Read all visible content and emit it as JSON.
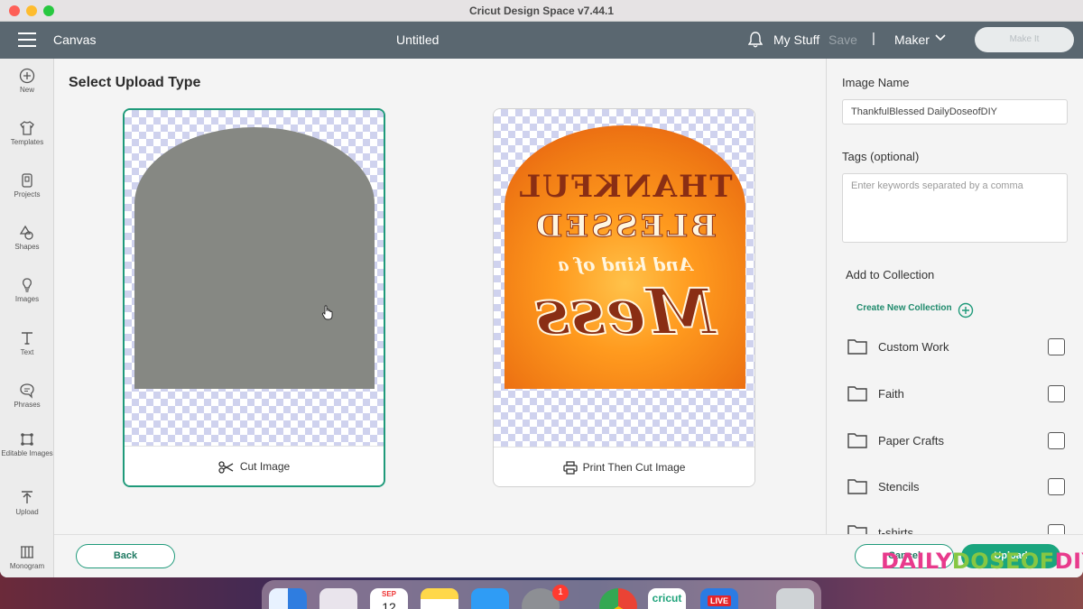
{
  "window": {
    "title": "Cricut Design Space  v7.44.1"
  },
  "topbar": {
    "canvas_label": "Canvas",
    "doc_title": "Untitled",
    "my_stuff": "My Stuff",
    "save": "Save",
    "separator": "|",
    "machine": "Maker",
    "make_it": "Make It"
  },
  "leftnav": {
    "items": [
      {
        "label": "New",
        "icon": "plus-circle-icon"
      },
      {
        "label": "Templates",
        "icon": "tshirt-icon"
      },
      {
        "label": "Projects",
        "icon": "projects-icon"
      },
      {
        "label": "Shapes",
        "icon": "shapes-icon"
      },
      {
        "label": "Images",
        "icon": "lightbulb-icon"
      },
      {
        "label": "Text",
        "icon": "text-icon"
      },
      {
        "label": "Phrases",
        "icon": "speech-bubble-icon"
      },
      {
        "label": "Editable Images",
        "icon": "editable-images-icon"
      },
      {
        "label": "Upload",
        "icon": "upload-icon"
      },
      {
        "label": "Monogram",
        "icon": "monogram-icon"
      }
    ]
  },
  "main": {
    "heading": "Select Upload Type",
    "cards": [
      {
        "label": "Cut Image",
        "selected": true
      },
      {
        "label": "Print Then Cut Image",
        "selected": false
      }
    ],
    "artwork": {
      "line1": "THANKFUL",
      "line2": "BLESSED",
      "line3": "And kind of a",
      "line4": "Mess"
    }
  },
  "bottombar": {
    "back": "Back",
    "cancel": "Cancel",
    "upload": "Upload"
  },
  "rightpanel": {
    "image_name_label": "Image Name",
    "image_name_value": "ThankfulBlessed DailyDoseofDIY",
    "tags_label": "Tags (optional)",
    "tags_placeholder": "Enter keywords separated by a comma",
    "collection_label": "Add to Collection",
    "create_collection": "Create New Collection",
    "collections": [
      {
        "name": "Custom Work",
        "checked": false
      },
      {
        "name": "Faith",
        "checked": false
      },
      {
        "name": "Paper Crafts",
        "checked": false
      },
      {
        "name": "Stencils",
        "checked": false
      },
      {
        "name": "t-shirts",
        "checked": false
      }
    ]
  },
  "watermark": {
    "part1": "DAILY",
    "part2": "DOSEOF",
    "part3": "DIY"
  },
  "dock": {
    "calendar_month": "SEP",
    "calendar_day": "12",
    "app_store_badge": "1",
    "live_label": "LIVE",
    "cricut_label": "cricut"
  },
  "colors": {
    "accent": "#1f9a7a",
    "topbar": "#5a6770",
    "upload_button": "#1aa57e"
  }
}
